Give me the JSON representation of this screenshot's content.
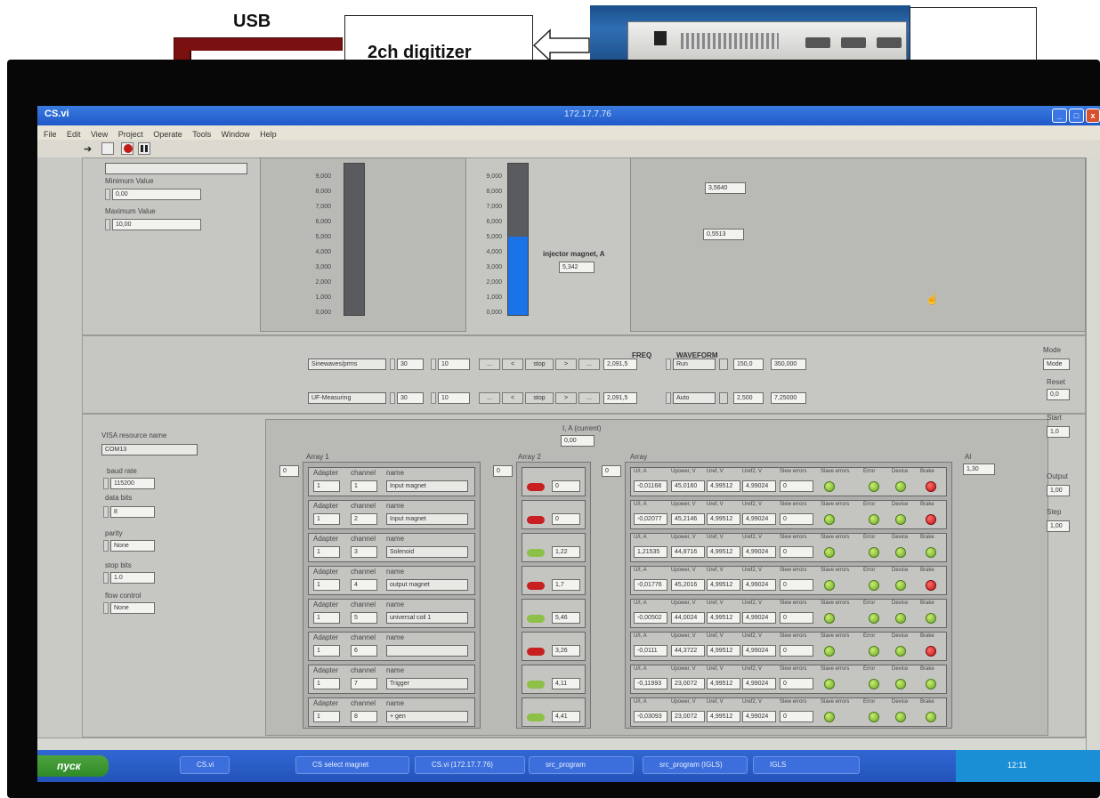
{
  "slide": {
    "usb_label": "USB",
    "digitizer_label": "2ch digitizer"
  },
  "window": {
    "title": "CS.vi",
    "title_center": "172.17.7.76",
    "menu": [
      "File",
      "Edit",
      "View",
      "Project",
      "Operate",
      "Tools",
      "Window",
      "Help"
    ]
  },
  "left_top": {
    "dropdown": "",
    "min_label": "Minimum Value",
    "min_value": "0,00",
    "max_label": "Maximum Value",
    "max_value": "10,00"
  },
  "gauge1": {
    "ticks": [
      "9,000",
      "8,000",
      "7,000",
      "6,000",
      "5,000",
      "4,000",
      "3,000",
      "2,000",
      "1,000",
      "0,000"
    ],
    "fill_fraction": 0.0
  },
  "gauge2": {
    "ticks": [
      "9,000",
      "8,000",
      "7,000",
      "6,000",
      "5,000",
      "4,000",
      "3,000",
      "2,000",
      "1,000",
      "0,000"
    ],
    "fill_fraction": 0.52,
    "label": "injector magnet, A",
    "value": "5,342"
  },
  "right_top": {
    "val1": "3,5640",
    "val2": "0,5513"
  },
  "middle_rows": [
    {
      "name": "Sinewaves/prms",
      "n1": "30",
      "n2": "10",
      "btns": [
        "...",
        "<",
        "stop",
        ">",
        "..."
      ],
      "field1": "2,091,5",
      "mode": "Run",
      "f2": "150,0",
      "f3": "350,000"
    },
    {
      "name": "UF-Measuring",
      "n1": "30",
      "n2": "10",
      "btns": [
        "...",
        "<",
        "stop",
        ">",
        "..."
      ],
      "field1": "2,091,5",
      "mode": "Auto",
      "f2": "2,500",
      "f3": "7,25000"
    }
  ],
  "middle_labels": {
    "col1": "FREQ",
    "col2": "WAVEFORM"
  },
  "com": {
    "title": "VISA resource name",
    "resource": "COM13",
    "baud_label": "baud rate",
    "baud": "115200",
    "databits_label": "data bits",
    "databits": "8",
    "parity_label": "parity",
    "parity": "None",
    "stopbits_label": "stop bits",
    "stopbits": "1.0",
    "flow_label": "flow control",
    "flow": "None"
  },
  "arrays": {
    "i_a_label": "I, A (current)",
    "i_a_value": "0,00",
    "array1_label": "Array 1",
    "array2_label": "Array 2",
    "array3_label": "Array",
    "right_label": "Al",
    "right_value": "1,30",
    "index": "0",
    "col_headers": [
      "Adapter",
      "channel",
      "name"
    ],
    "chan_rows": [
      {
        "adapter": "1",
        "channel": "1",
        "name": "Input magnet"
      },
      {
        "adapter": "1",
        "channel": "2",
        "name": "Input magnet"
      },
      {
        "adapter": "1",
        "channel": "3",
        "name": "Solenoid"
      },
      {
        "adapter": "1",
        "channel": "4",
        "name": "output magnet"
      },
      {
        "adapter": "1",
        "channel": "5",
        "name": "universal coil 1"
      },
      {
        "adapter": "1",
        "channel": "6",
        "name": ""
      },
      {
        "adapter": "1",
        "channel": "7",
        "name": "Trigger"
      },
      {
        "adapter": "1",
        "channel": "8",
        "name": "+ gen"
      }
    ],
    "enable_rows": [
      {
        "state": "red",
        "value": "0"
      },
      {
        "state": "red",
        "value": "0"
      },
      {
        "state": "green",
        "value": "1,22"
      },
      {
        "state": "red",
        "value": "1,7"
      },
      {
        "state": "green",
        "value": "5,46"
      },
      {
        "state": "red",
        "value": "3,26"
      },
      {
        "state": "green",
        "value": "4,11"
      },
      {
        "state": "green",
        "value": "4,41"
      }
    ],
    "status_headers": [
      "U/I, A",
      "Upower, V",
      "Uref, V",
      "Uref2, V",
      "Slew errors",
      "Slave errors",
      "Error",
      "Device",
      "Brake"
    ],
    "status_rows": [
      {
        "v1": "-0,01168",
        "v2": "45,0160",
        "v3": "4,99512",
        "v4": "4,99024",
        "v5": "0",
        "leds": [
          "green",
          "green",
          "green",
          "red"
        ]
      },
      {
        "v1": "-0,02077",
        "v2": "45,2146",
        "v3": "4,99512",
        "v4": "4,99024",
        "v5": "0",
        "leds": [
          "green",
          "green",
          "green",
          "red"
        ]
      },
      {
        "v1": "1,21535",
        "v2": "44,8716",
        "v3": "4,99512",
        "v4": "4,99024",
        "v5": "0",
        "leds": [
          "green",
          "green",
          "green",
          "green"
        ]
      },
      {
        "v1": "-0,01776",
        "v2": "45,2016",
        "v3": "4,99512",
        "v4": "4,99024",
        "v5": "0",
        "leds": [
          "green",
          "green",
          "green",
          "red"
        ]
      },
      {
        "v1": "-0,00502",
        "v2": "44,0024",
        "v3": "4,99512",
        "v4": "4,99024",
        "v5": "0",
        "leds": [
          "green",
          "green",
          "green",
          "green"
        ]
      },
      {
        "v1": "-0,0111",
        "v2": "44,3722",
        "v3": "4,99512",
        "v4": "4,99024",
        "v5": "0",
        "leds": [
          "green",
          "green",
          "green",
          "red"
        ]
      },
      {
        "v1": "-0,11993",
        "v2": "23,0072",
        "v3": "4,99512",
        "v4": "4,99024",
        "v5": "0",
        "leds": [
          "green",
          "green",
          "green",
          "green"
        ]
      },
      {
        "v1": "-0,03093",
        "v2": "23,0072",
        "v3": "4,99512",
        "v4": "4,99024",
        "v5": "0",
        "leds": [
          "green",
          "green",
          "green",
          "green"
        ]
      }
    ]
  },
  "far_right": {
    "labels": [
      "Mode",
      "Reset",
      "Start",
      "Output",
      "Step"
    ],
    "values": [
      "Mode",
      "0,0",
      "1,0",
      "1,00",
      "1,00"
    ]
  },
  "taskbar": {
    "start": "пуск",
    "tasks": [
      "CS.vi",
      "CS select magnet",
      "CS.vi (172.17.7.76)",
      "src_program",
      "src_program (IGLS)",
      "IGLS"
    ],
    "clock": "12:11"
  },
  "colors": {
    "gauge_fill": "#1a73e8",
    "titlebar": "#2a63d0",
    "led_green": "#8cc046",
    "led_red": "#c21515"
  }
}
